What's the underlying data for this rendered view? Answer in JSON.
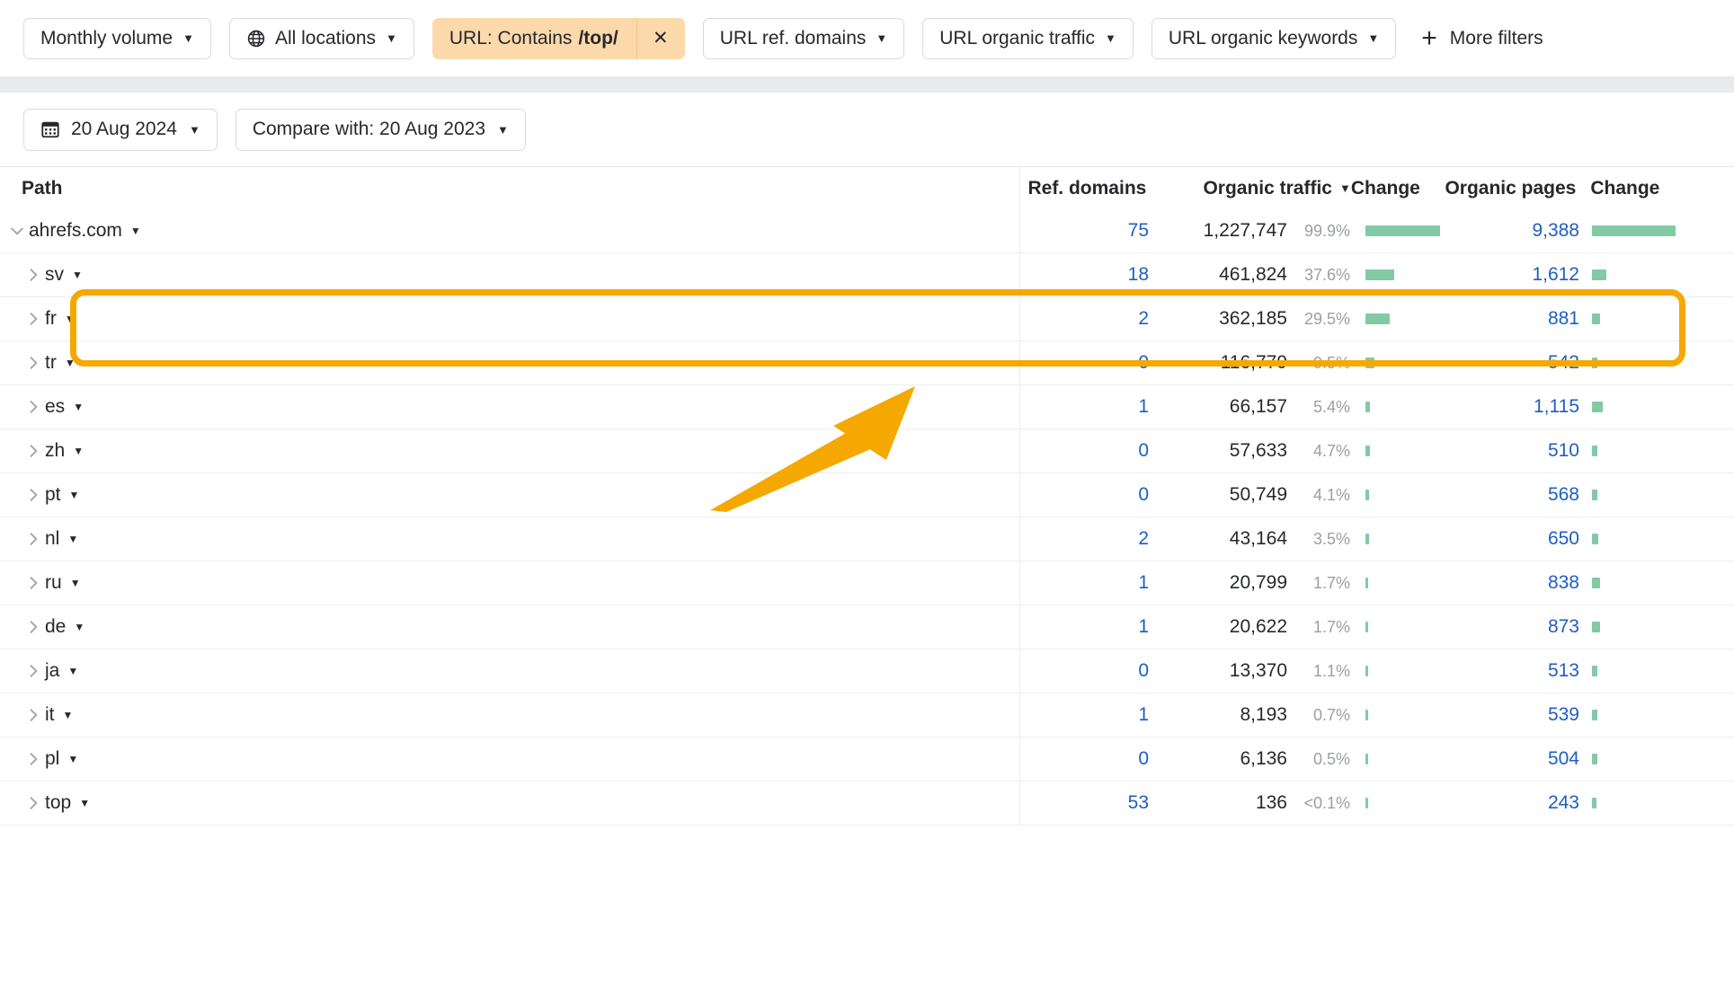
{
  "filters": {
    "items": [
      {
        "label": "Monthly volume",
        "icon": "",
        "caret": "▼",
        "active": false
      },
      {
        "label": "All locations",
        "icon": "globe-icon",
        "caret": "▼",
        "active": false
      },
      {
        "label_prefix": "URL: Contains",
        "label_bold": "/top/",
        "close": "✕",
        "active": true
      },
      {
        "label": "URL ref. domains",
        "icon": "",
        "caret": "▼",
        "active": false
      },
      {
        "label": "URL organic traffic",
        "icon": "",
        "caret": "▼",
        "active": false
      },
      {
        "label": "URL organic keywords",
        "icon": "",
        "caret": "▼",
        "active": false
      }
    ],
    "more_filters": "More filters",
    "more_filters_plus": "+"
  },
  "date_bar": {
    "date": "20 Aug 2024",
    "date_caret": "▼",
    "compare": "Compare with: 20 Aug 2023",
    "compare_caret": "▼"
  },
  "table": {
    "headers": {
      "path": "Path",
      "ref_domains": "Ref. domains",
      "organic_traffic": "Organic traffic",
      "sort_caret": "▼",
      "change1": "Change",
      "organic_pages": "Organic pages",
      "change2": "Change"
    },
    "rows": [
      {
        "label": "ahrefs.com",
        "caret": "▼",
        "chevron": "v",
        "level": 0,
        "ref_domains": "75",
        "organic_traffic": "1,227,747",
        "share": "99.9%",
        "change1_w": 83,
        "organic_pages": "9,388",
        "change2_w": 93
      },
      {
        "label": "sv",
        "caret": "▼",
        "chevron": ">",
        "level": 1,
        "ref_domains": "18",
        "organic_traffic": "461,824",
        "share": "37.6%",
        "change1_w": 32,
        "organic_pages": "1,612",
        "change2_w": 16
      },
      {
        "label": "fr",
        "caret": "▼",
        "chevron": ">",
        "level": 1,
        "ref_domains": "2",
        "organic_traffic": "362,185",
        "share": "29.5%",
        "change1_w": 27,
        "organic_pages": "881",
        "change2_w": 9
      },
      {
        "label": "tr",
        "caret": "▼",
        "chevron": ">",
        "level": 1,
        "ref_domains": "0",
        "organic_traffic": "116,779",
        "share": "9.5%",
        "change1_w": 10,
        "organic_pages": "542",
        "change2_w": 6
      },
      {
        "label": "es",
        "caret": "▼",
        "chevron": ">",
        "level": 1,
        "ref_domains": "1",
        "organic_traffic": "66,157",
        "share": "5.4%",
        "change1_w": 5,
        "organic_pages": "1,115",
        "change2_w": 12
      },
      {
        "label": "zh",
        "caret": "▼",
        "chevron": ">",
        "level": 1,
        "ref_domains": "0",
        "organic_traffic": "57,633",
        "share": "4.7%",
        "change1_w": 5,
        "organic_pages": "510",
        "change2_w": 6
      },
      {
        "label": "pt",
        "caret": "▼",
        "chevron": ">",
        "level": 1,
        "ref_domains": "0",
        "organic_traffic": "50,749",
        "share": "4.1%",
        "change1_w": 4,
        "organic_pages": "568",
        "change2_w": 6
      },
      {
        "label": "nl",
        "caret": "▼",
        "chevron": ">",
        "level": 1,
        "ref_domains": "2",
        "organic_traffic": "43,164",
        "share": "3.5%",
        "change1_w": 4,
        "organic_pages": "650",
        "change2_w": 7
      },
      {
        "label": "ru",
        "caret": "▼",
        "chevron": ">",
        "level": 1,
        "ref_domains": "1",
        "organic_traffic": "20,799",
        "share": "1.7%",
        "change1_w": 3,
        "organic_pages": "838",
        "change2_w": 9
      },
      {
        "label": "de",
        "caret": "▼",
        "chevron": ">",
        "level": 1,
        "ref_domains": "1",
        "organic_traffic": "20,622",
        "share": "1.7%",
        "change1_w": 3,
        "organic_pages": "873",
        "change2_w": 9
      },
      {
        "label": "ja",
        "caret": "▼",
        "chevron": ">",
        "level": 1,
        "ref_domains": "0",
        "organic_traffic": "13,370",
        "share": "1.1%",
        "change1_w": 3,
        "organic_pages": "513",
        "change2_w": 6
      },
      {
        "label": "it",
        "caret": "▼",
        "chevron": ">",
        "level": 1,
        "ref_domains": "1",
        "organic_traffic": "8,193",
        "share": "0.7%",
        "change1_w": 3,
        "organic_pages": "539",
        "change2_w": 6
      },
      {
        "label": "pl",
        "caret": "▼",
        "chevron": ">",
        "level": 1,
        "ref_domains": "0",
        "organic_traffic": "6,136",
        "share": "0.5%",
        "change1_w": 3,
        "organic_pages": "504",
        "change2_w": 6
      },
      {
        "label": "top",
        "caret": "▼",
        "chevron": ">",
        "level": 1,
        "ref_domains": "53",
        "organic_traffic": "136",
        "share": "<0.1%",
        "change1_w": 3,
        "organic_pages": "243",
        "change2_w": 5
      }
    ]
  },
  "colors": {
    "accent_orange": "#f5a800",
    "active_filter_bg": "#fbd9ab",
    "link_blue": "#1f5ec1",
    "bar_green": "#82c9a5"
  }
}
